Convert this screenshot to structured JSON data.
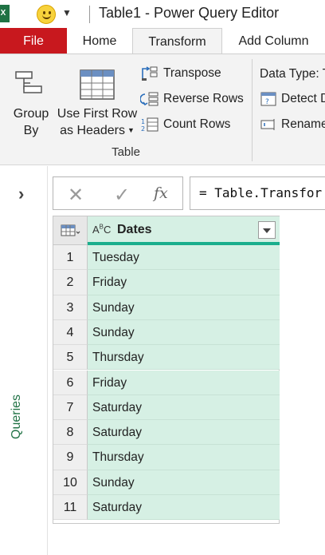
{
  "window": {
    "title": "Table1 - Power Query Editor"
  },
  "tabs": [
    {
      "label": "File"
    },
    {
      "label": "Home"
    },
    {
      "label": "Transform",
      "active": true
    },
    {
      "label": "Add Column"
    }
  ],
  "ribbon": {
    "group_by": {
      "line1": "Group",
      "line2": "By"
    },
    "use_first_row": {
      "line1": "Use First Row",
      "line2": "as Headers"
    },
    "transpose": "Transpose",
    "reverse_rows": "Reverse Rows",
    "count_rows": "Count Rows",
    "group_label": "Table",
    "data_type": "Data Type: T",
    "detect_data_type": "Detect D",
    "rename": "Rename"
  },
  "queries_pane": {
    "label": "Queries"
  },
  "formula_bar": {
    "formula": "= Table.Transfor"
  },
  "grid": {
    "column": {
      "type_icon": "ABC",
      "header": "Dates"
    },
    "rows": [
      {
        "n": "1",
        "value": "Tuesday"
      },
      {
        "n": "2",
        "value": "Friday"
      },
      {
        "n": "3",
        "value": "Sunday"
      },
      {
        "n": "4",
        "value": "Sunday"
      },
      {
        "n": "5",
        "value": "Thursday"
      },
      {
        "n": "6",
        "value": "Friday"
      },
      {
        "n": "7",
        "value": "Saturday"
      },
      {
        "n": "8",
        "value": "Saturday"
      },
      {
        "n": "9",
        "value": "Thursday"
      },
      {
        "n": "10",
        "value": "Sunday"
      },
      {
        "n": "11",
        "value": "Saturday"
      }
    ]
  },
  "colors": {
    "file_tab": "#c8181e",
    "column_fill": "#d6f0e4",
    "column_accent": "#1aae8d",
    "queries_text": "#217346"
  }
}
